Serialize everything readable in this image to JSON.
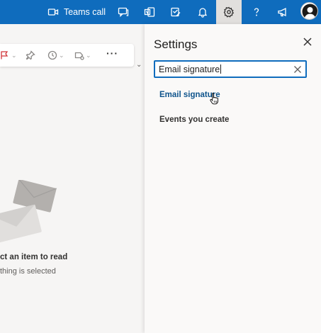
{
  "topbar": {
    "teams_call_label": "Teams call",
    "icons": [
      "video-camera-icon",
      "chat-icon",
      "office-icon",
      "todo-icon",
      "bell-icon",
      "gear-icon",
      "help-icon",
      "megaphone-icon",
      "avatar"
    ],
    "accent": "#0f6cbd"
  },
  "reading_pane": {
    "toolbar_icons": [
      "flag-icon",
      "pin-icon",
      "clock-icon",
      "categorize-icon",
      "more-icon"
    ],
    "more_label": "···",
    "empty_title": "ct an item to read",
    "empty_subtitle": "thing is selected"
  },
  "settings": {
    "title": "Settings",
    "search_value": "Email signature",
    "results": [
      "Email signature",
      "Events you create"
    ]
  }
}
